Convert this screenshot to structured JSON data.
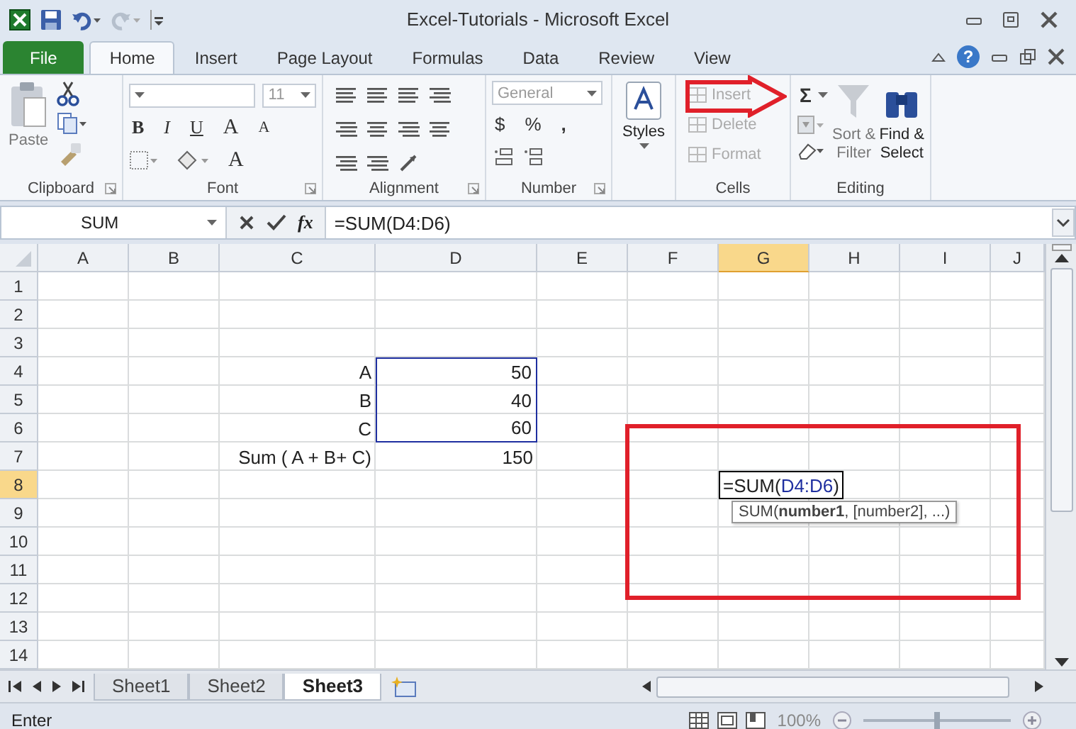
{
  "window": {
    "title": "Excel-Tutorials  -  Microsoft Excel"
  },
  "ribbon_tabs": [
    {
      "label": "File",
      "kind": "file",
      "selected": false
    },
    {
      "label": "Home",
      "kind": "tab",
      "selected": true
    },
    {
      "label": "Insert",
      "kind": "tab",
      "selected": false
    },
    {
      "label": "Page Layout",
      "kind": "tab",
      "selected": false
    },
    {
      "label": "Formulas",
      "kind": "tab",
      "selected": false
    },
    {
      "label": "Data",
      "kind": "tab",
      "selected": false
    },
    {
      "label": "Review",
      "kind": "tab",
      "selected": false
    },
    {
      "label": "View",
      "kind": "tab",
      "selected": false
    }
  ],
  "help": {
    "label": "?"
  },
  "ribbon": {
    "clipboard": {
      "title": "Clipboard",
      "paste": "Paste"
    },
    "font": {
      "title": "Font",
      "size": "11",
      "bold": "B",
      "italic": "I",
      "underline": "U",
      "grow": "A",
      "shrink": "A",
      "font_color_label": "A"
    },
    "alignment": {
      "title": "Alignment"
    },
    "number": {
      "title": "Number",
      "format": "General",
      "currency": "$",
      "percent": "%",
      "comma": ","
    },
    "styles": {
      "label": "Styles"
    },
    "cells": {
      "title": "Cells",
      "buttons": [
        {
          "label": "Insert",
          "disabled": true
        },
        {
          "label": "Delete",
          "disabled": true
        },
        {
          "label": "Format",
          "disabled": true
        }
      ]
    },
    "editing": {
      "title": "Editing",
      "autosum": "Σ",
      "buttons": [
        {
          "label": "Sort & Filter",
          "disabled": true
        },
        {
          "label": "Find & Select",
          "disabled": false
        }
      ]
    }
  },
  "formula_bar": {
    "name_box": "SUM",
    "function_label": "fx",
    "formula": "=SUM(D4:D6)"
  },
  "sheet": {
    "columns": [
      {
        "label": "A",
        "selected": false
      },
      {
        "label": "B",
        "selected": false
      },
      {
        "label": "C",
        "selected": false
      },
      {
        "label": "D",
        "selected": false
      },
      {
        "label": "E",
        "selected": false
      },
      {
        "label": "F",
        "selected": false
      },
      {
        "label": "G",
        "selected": true
      },
      {
        "label": "H",
        "selected": false
      },
      {
        "label": "I",
        "selected": false
      },
      {
        "label": "J",
        "selected": false
      }
    ],
    "rows": [
      {
        "label": "1",
        "selected": false
      },
      {
        "label": "2",
        "selected": false
      },
      {
        "label": "3",
        "selected": false
      },
      {
        "label": "4",
        "selected": false,
        "cells": [
          null,
          null,
          {
            "kind": "value",
            "text": "A",
            "referenced": false
          },
          {
            "kind": "value",
            "text": "50",
            "referenced": true
          }
        ]
      },
      {
        "label": "5",
        "selected": false,
        "cells": [
          null,
          null,
          {
            "kind": "value",
            "text": "B",
            "referenced": false
          },
          {
            "kind": "value",
            "text": "40",
            "referenced": true
          }
        ]
      },
      {
        "label": "6",
        "selected": false,
        "cells": [
          null,
          null,
          {
            "kind": "value",
            "text": "C",
            "referenced": false
          },
          {
            "kind": "value",
            "text": "60",
            "referenced": true
          }
        ]
      },
      {
        "label": "7",
        "selected": false,
        "cells": [
          null,
          null,
          {
            "kind": "value",
            "text": "Sum ( A + B+ C)",
            "referenced": false
          },
          {
            "kind": "value",
            "text": "150",
            "referenced": false
          }
        ]
      },
      {
        "label": "8",
        "selected": true,
        "cells": [
          null,
          null,
          null,
          null,
          null,
          null,
          {
            "kind": "editing",
            "prefix": "=SUM(",
            "reference": "D4:D6",
            "suffix": ")"
          }
        ]
      },
      {
        "label": "9",
        "selected": false
      },
      {
        "label": "10",
        "selected": false
      },
      {
        "label": "11",
        "selected": false
      },
      {
        "label": "12",
        "selected": false
      },
      {
        "label": "13",
        "selected": false
      },
      {
        "label": "14",
        "selected": false
      }
    ],
    "tooltip": {
      "text": "SUM(**number1**, [number2], ...)"
    }
  },
  "sheet_tabs": [
    {
      "label": "Sheet1",
      "selected": false
    },
    {
      "label": "Sheet2",
      "selected": false
    },
    {
      "label": "Sheet3",
      "selected": true
    }
  ],
  "status_bar": {
    "mode": "Enter",
    "zoom": {
      "reading": "100%",
      "level": 0.5
    }
  }
}
